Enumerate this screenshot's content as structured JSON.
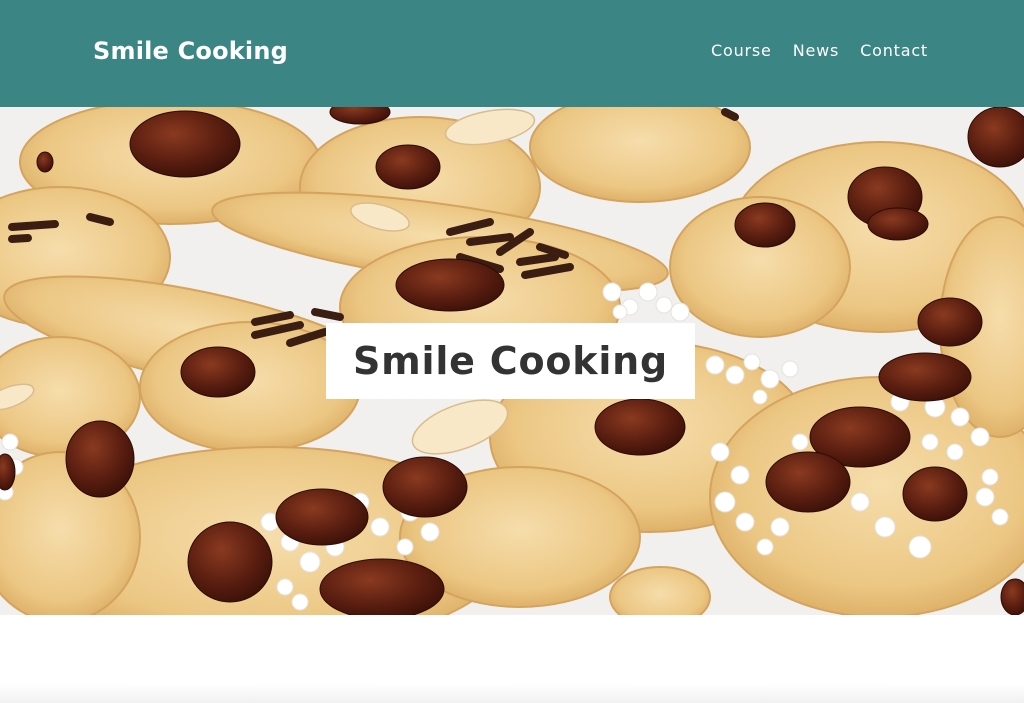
{
  "header": {
    "logo": "Smile Cooking",
    "background_color": "#3b8584",
    "nav": [
      {
        "label": "Course"
      },
      {
        "label": "News"
      },
      {
        "label": "Contact"
      }
    ]
  },
  "hero": {
    "title": "Smile Cooking",
    "image_description_icon": "cookies-photo-icon"
  }
}
